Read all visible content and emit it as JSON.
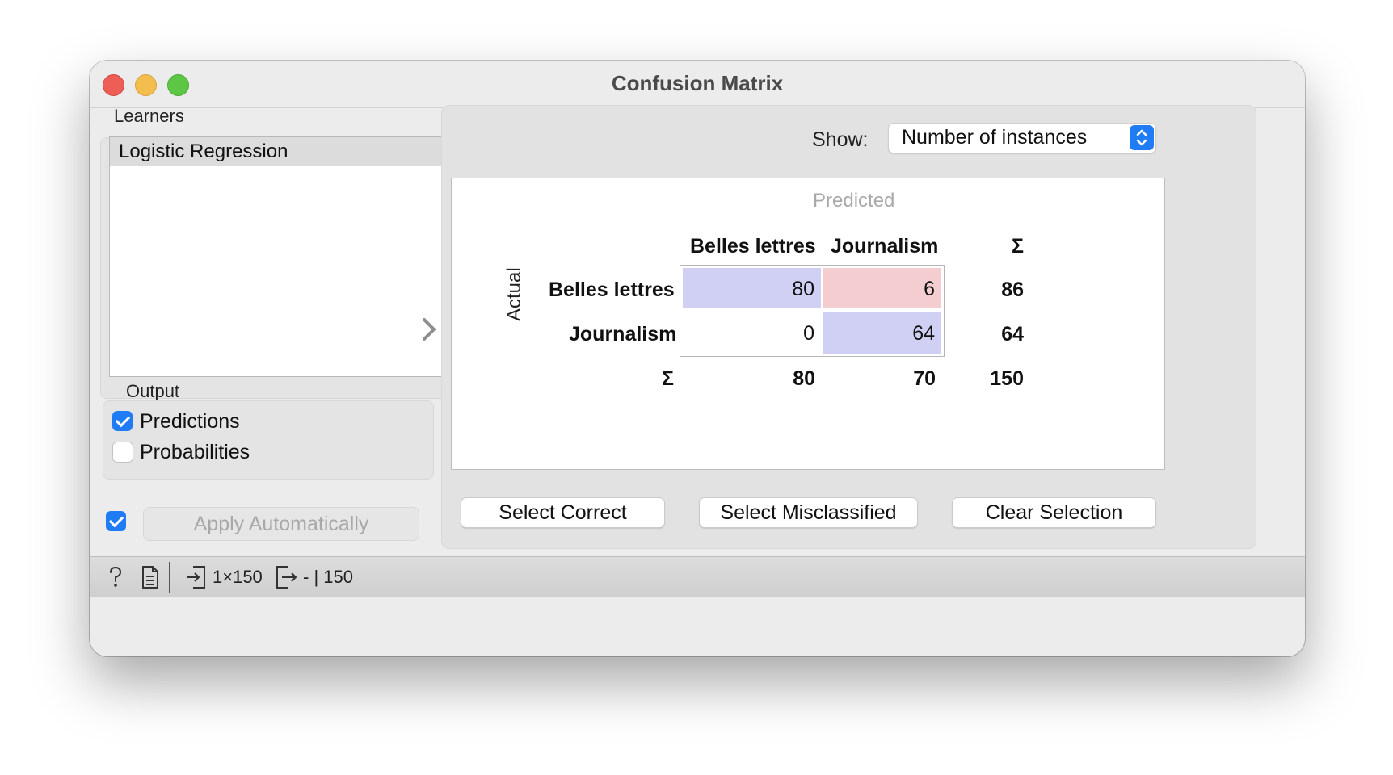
{
  "window": {
    "title": "Confusion Matrix"
  },
  "learners": {
    "label": "Learners",
    "items": [
      "Logistic Regression"
    ]
  },
  "output": {
    "label": "Output",
    "predictions_label": "Predictions",
    "predictions_checked": true,
    "probabilities_label": "Probabilities",
    "probabilities_checked": false
  },
  "apply": {
    "checked": true,
    "label": "Apply Automatically"
  },
  "show": {
    "label": "Show:",
    "value": "Number of instances"
  },
  "matrix": {
    "predicted_label": "Predicted",
    "actual_label": "Actual",
    "sum_symbol": "Σ",
    "col_headers": [
      "Belles lettres",
      "Journalism"
    ],
    "row_headers": [
      "Belles lettres",
      "Journalism"
    ],
    "cells": [
      [
        "80",
        "6"
      ],
      [
        "0",
        "64"
      ]
    ],
    "row_totals": [
      "86",
      "64"
    ],
    "col_totals": [
      "80",
      "70"
    ],
    "grand_total": "150",
    "colors": {
      "correct": "#cfd0f3",
      "misclassified": "#f3cdcf",
      "zero": "#ffffff"
    }
  },
  "buttons": {
    "select_correct": "Select Correct",
    "select_misclassified": "Select Misclassified",
    "clear_selection": "Clear Selection"
  },
  "statusbar": {
    "input_summary": "1×150",
    "output_summary": "- | 150",
    "icons": [
      "help-icon",
      "report-icon",
      "input-icon",
      "output-icon"
    ]
  }
}
